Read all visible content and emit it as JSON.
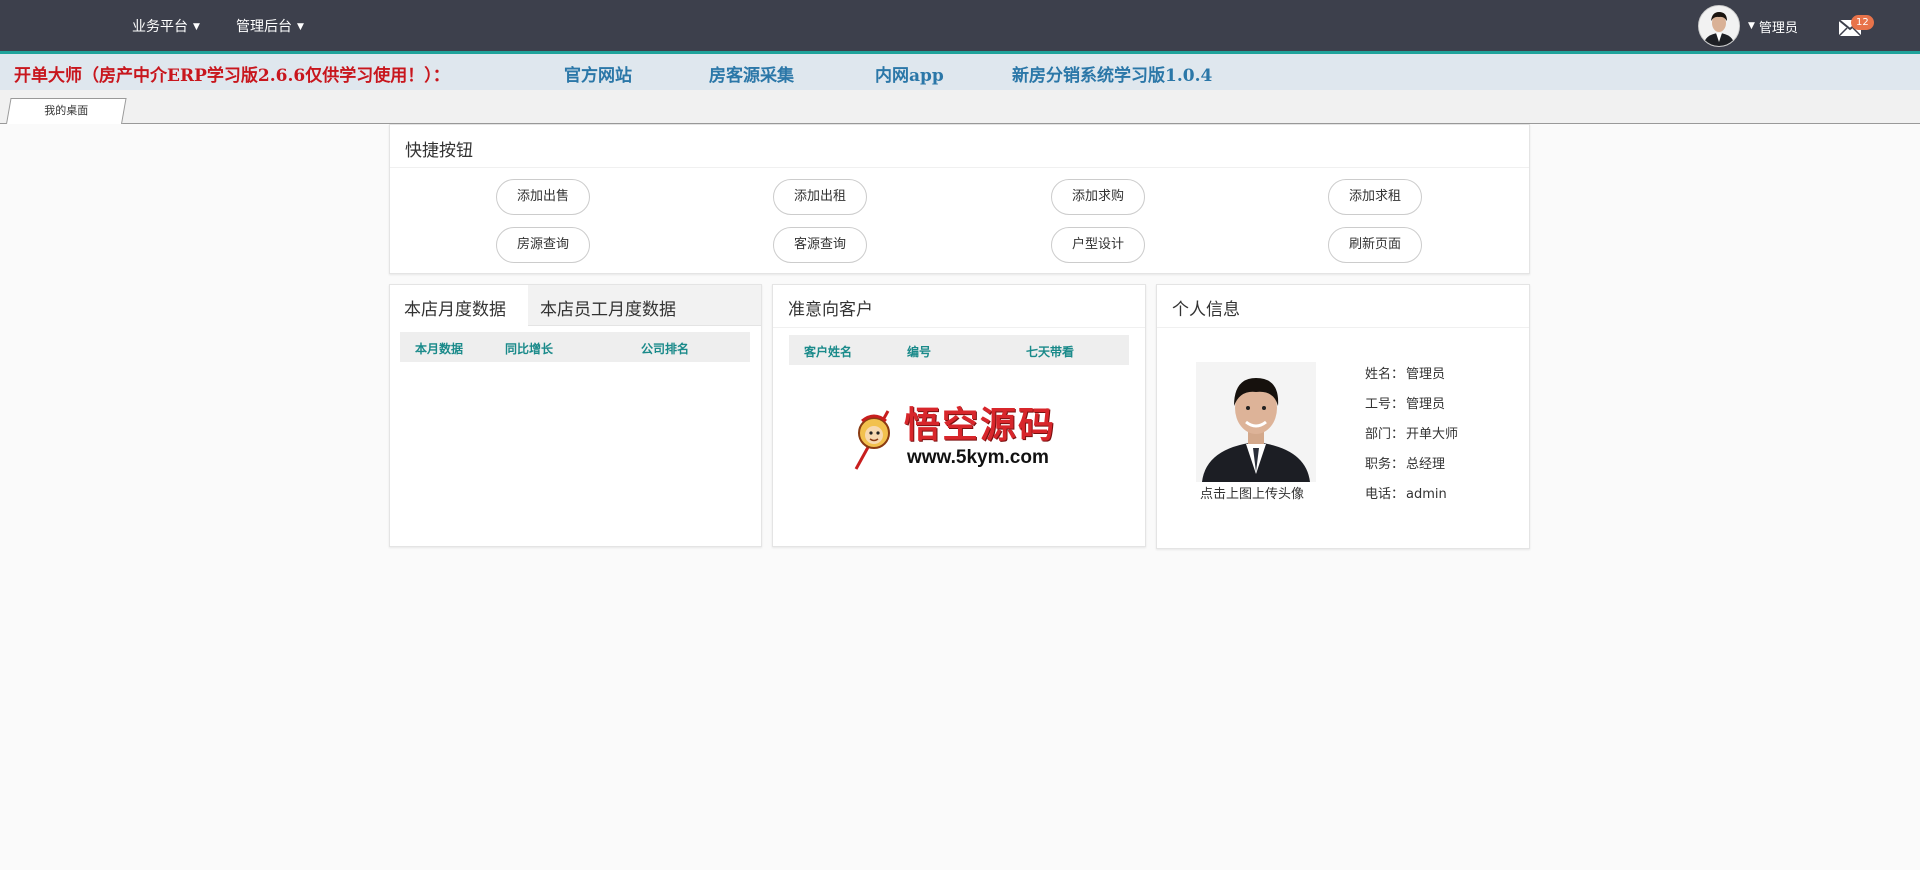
{
  "navbar": {
    "menus": [
      "业务平台",
      "管理后台"
    ],
    "username": "管理员",
    "mail_count": "12"
  },
  "linkbar": {
    "notice": "开单大师（房产中介ERP学习版2.6.6仅供学习使用！）：",
    "links": [
      "官方网站",
      "房客源采集",
      "内网app",
      "新房分销系统学习版1.0.4"
    ]
  },
  "tabs": {
    "home": "我的桌面"
  },
  "quick": {
    "title": "快捷按钮",
    "buttons": [
      "添加出售",
      "添加出租",
      "添加求购",
      "添加求租",
      "房源查询",
      "客源查询",
      "户型设计",
      "刷新页面"
    ]
  },
  "monthly": {
    "tab_store": "本店月度数据",
    "tab_staff": "本店员工月度数据",
    "columns": [
      "本月数据",
      "同比增长",
      "公司排名"
    ]
  },
  "intent": {
    "title": "准意向客户",
    "columns": [
      "客户姓名",
      "编号",
      "七天带看"
    ],
    "watermark_text": "悟空源码",
    "watermark_url": "www.5kym.com"
  },
  "profile": {
    "title": "个人信息",
    "upload_hint": "点击上图上传头像",
    "fields": [
      {
        "label": "姓名：",
        "value": "管理员"
      },
      {
        "label": "工号：",
        "value": "管理员"
      },
      {
        "label": "部门：",
        "value": "开单大师"
      },
      {
        "label": "职务：",
        "value": "总经理"
      },
      {
        "label": "电话：",
        "value": "admin"
      }
    ]
  },
  "colors": {
    "navbar_bg": "#3d404c",
    "accent_teal": "#1fa39b",
    "notice_red": "#c8161d",
    "link_blue": "#2b77a8",
    "badge_orange": "#e8734a"
  }
}
